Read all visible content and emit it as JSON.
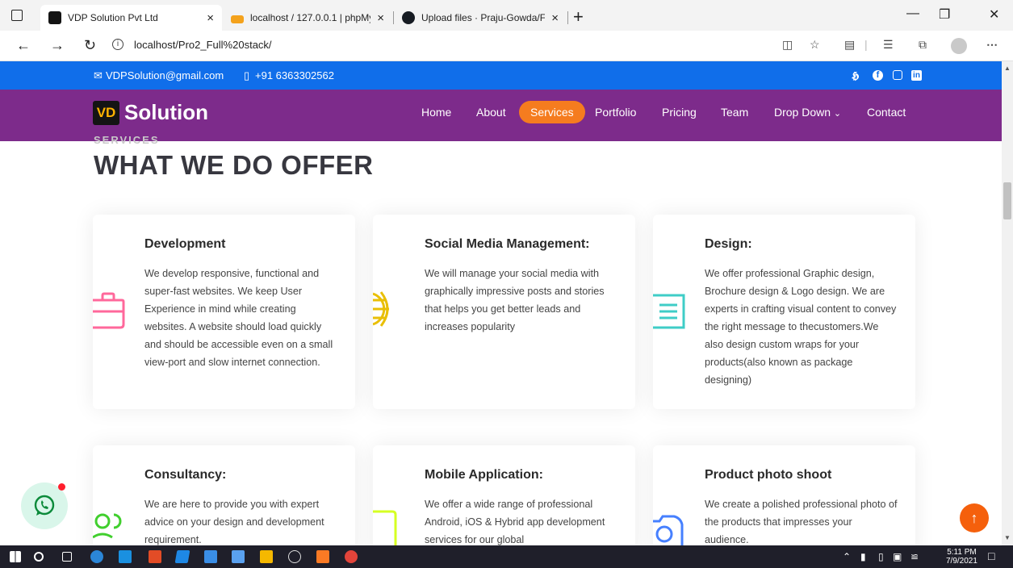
{
  "browser": {
    "tabs": [
      {
        "title": "VDP Solution Pvt Ltd",
        "close": "×"
      },
      {
        "title": "localhost / 127.0.0.1 | phpMyAdm",
        "close": "×"
      },
      {
        "title": "Upload files · Praju-Gowda/FSW_",
        "close": "×"
      }
    ],
    "new_tab": "+",
    "url": "localhost/Pro2_Full%20stack/",
    "icons": [
      "back-icon",
      "forward-icon",
      "refresh-icon",
      "info-icon",
      "immersive-reader-icon",
      "favorite-icon",
      "extension-icon",
      "favorites-list-icon",
      "collections-icon",
      "profile-icon",
      "more-icon"
    ]
  },
  "site": {
    "topbar": {
      "email": "VDPSolution@gmail.com",
      "phone": "+91 6363302562",
      "social": [
        "twitter-icon",
        "facebook-icon",
        "instagram-icon",
        "linkedin-icon"
      ]
    },
    "logo": {
      "mark": "VD",
      "text": "Solution"
    },
    "menu": [
      "Home",
      "About",
      "Services",
      "Portfolio",
      "Pricing",
      "Team",
      "Drop Down",
      "Contact"
    ],
    "active_menu": "Services",
    "section": {
      "ghost": "SERVICES",
      "title": "WHAT WE DO OFFER"
    },
    "cards": [
      {
        "title": "Development",
        "desc": "We develop responsive, functional and super-fast websites. We keep User Experience in mind while creating websites. A website should load quickly and should be accessible even on a small view-port and slow internet connection.",
        "icon": "briefcase-icon",
        "color": "#ff689b"
      },
      {
        "title": "Social Media Management:",
        "desc": "We will manage your social media with graphically impressive posts and stories that helps you get better leads and increases popularity",
        "icon": "globe-icon",
        "color": "#e9bf06"
      },
      {
        "title": "Design:",
        "desc": "We offer professional Graphic design, Brochure design & Logo design. We are experts in crafting visual content to convey the right message to thecustomers.We also design custom wraps for your products(also known as package designing)",
        "icon": "list-icon",
        "color": "#3fcdc7"
      },
      {
        "title": "Consultancy:",
        "desc": "We are here to provide you with expert advice on your design and development requirement.",
        "icon": "users-icon",
        "color": "#41cf2e"
      },
      {
        "title": "Mobile Application:",
        "desc": "We offer a wide range of professional Android, iOS & Hybrid app development services for our global",
        "icon": "mobile-icon",
        "color": "#d6ff22"
      },
      {
        "title": "Product photo shoot",
        "desc": "We create a polished professional photo of the products that impresses your audience.",
        "icon": "camera-icon",
        "color": "#4680ff"
      }
    ]
  },
  "floating": {
    "whatsapp": "whatsapp-icon",
    "back_to_top": "↑"
  },
  "taskbar": {
    "time": "5:11 PM",
    "date": "7/9/2021"
  }
}
